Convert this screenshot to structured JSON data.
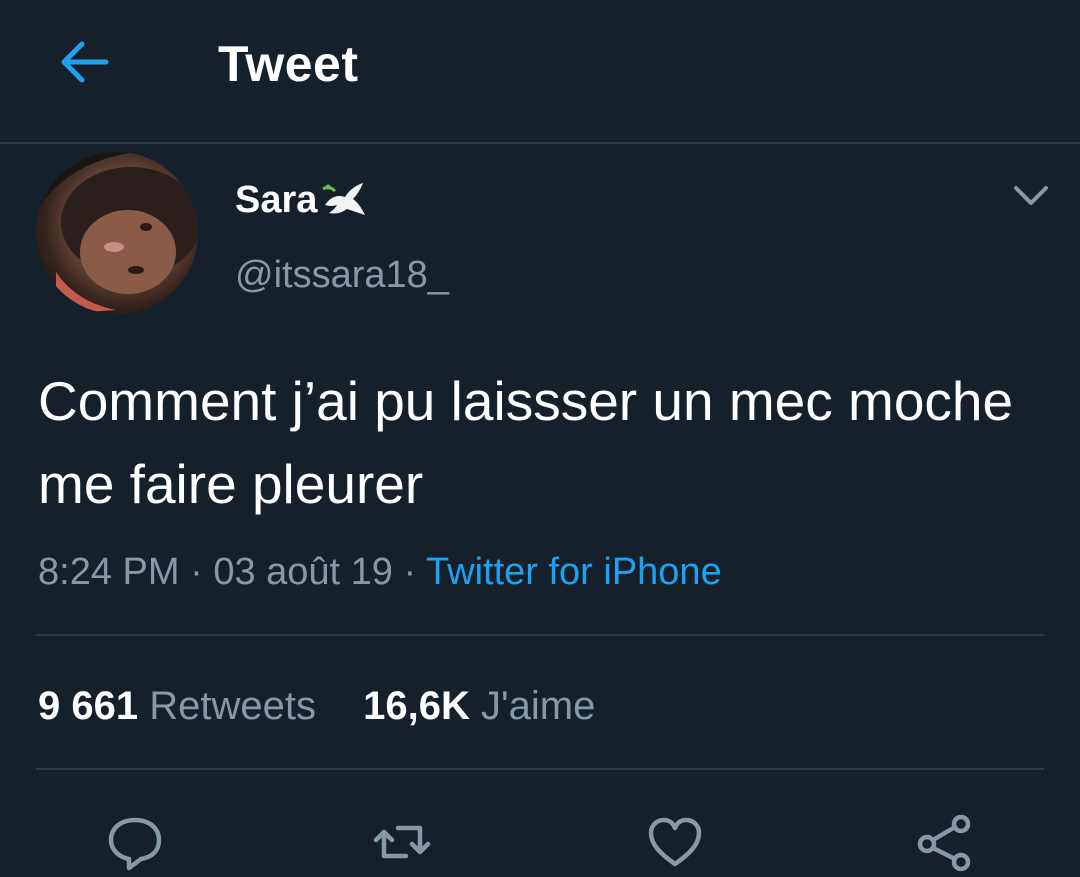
{
  "header": {
    "title": "Tweet",
    "back_icon": "arrow-left-icon",
    "accent_color": "#1da1f2"
  },
  "author": {
    "name": "Sara",
    "emoji": "dove-icon",
    "handle": "@itssara18_"
  },
  "tweet": {
    "text": "Comment j’ai pu laissser un mec moche me faire pleurer",
    "time": "8:24 PM",
    "separator": "·",
    "date": "03 août 19",
    "source": "Twitter for iPhone"
  },
  "stats": {
    "retweets_count": "9 661",
    "retweets_label": "Retweets",
    "likes_count": "16,6K",
    "likes_label": "J'aime"
  },
  "actions": [
    "reply-icon",
    "retweet-icon",
    "heart-icon",
    "share-icon"
  ],
  "colors": {
    "background": "#15202b",
    "divider": "#2b3a48",
    "secondary_text": "#8899a6",
    "link": "#1da1f2"
  }
}
